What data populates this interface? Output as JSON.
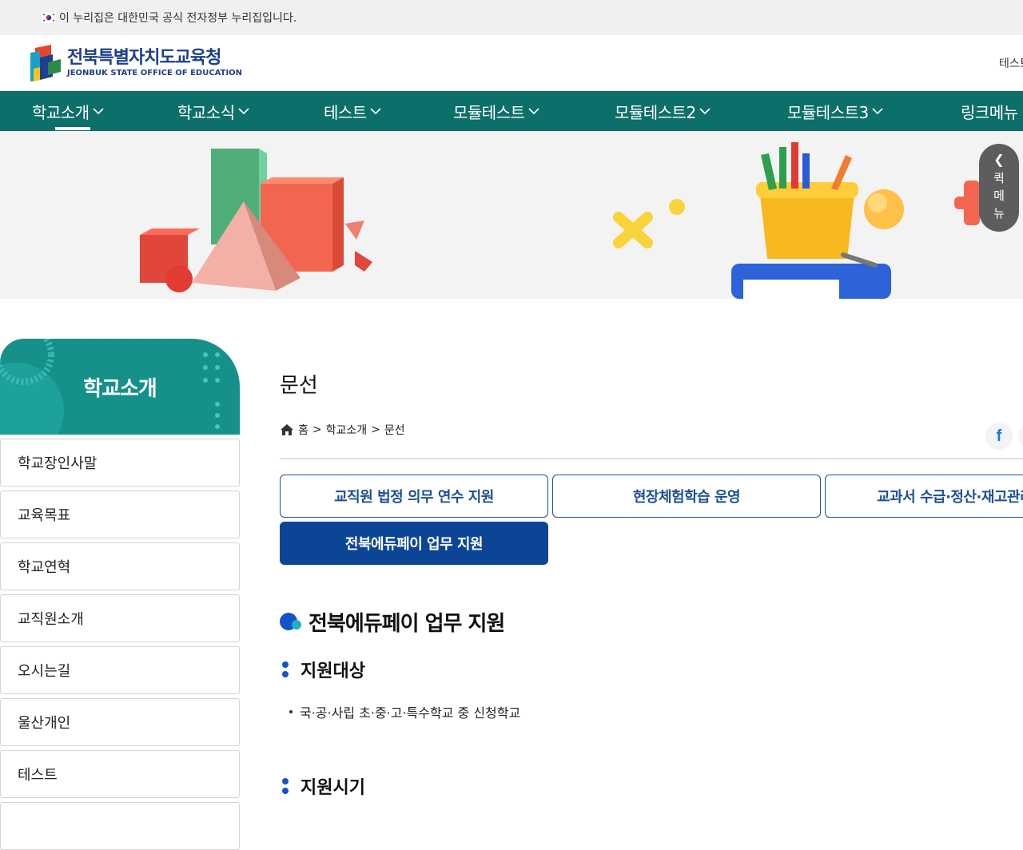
{
  "gov_banner": {
    "text": "이 누리집은 대한민국 공식 전자정부 누리집입니다."
  },
  "logo": {
    "name_ko": "전북특별자치도교육청",
    "name_en": "JEONBUK STATE OFFICE OF EDUCATION"
  },
  "header": {
    "right_text": "테스트"
  },
  "gnb": {
    "items": [
      "학교소개",
      "학교소식",
      "테스트",
      "모듈테스트",
      "모듈테스트2",
      "모듈테스트3",
      "링크메뉴"
    ],
    "active_index": 0
  },
  "quick_menu": {
    "arrow": "❮",
    "label_lines": [
      "퀵",
      "메",
      "뉴"
    ]
  },
  "lnb": {
    "title": "학교소개",
    "items": [
      "학교장인사말",
      "교육목표",
      "학교연혁",
      "교직원소개",
      "오시는길",
      "울산개인",
      "테스트",
      ""
    ]
  },
  "content": {
    "page_title": "문선",
    "breadcrumb": [
      "홈",
      "학교소개",
      "문선"
    ],
    "breadcrumb_separator": ">",
    "share_facebook": "f",
    "tabs": [
      {
        "label": "교직원 법정 의무 연수 지원",
        "active": false
      },
      {
        "label": "현장체험학습 운영",
        "active": false
      },
      {
        "label": "교과서 수급·정산·재고관리",
        "active": false
      },
      {
        "label": "전북에듀페이 업무 지원",
        "active": true
      }
    ],
    "section_title": "전북에듀페이 업무 지원",
    "subsections": [
      {
        "title": "지원대상",
        "items": [
          "국·공·사립 초·중·고·특수학교 중 신청학교"
        ]
      },
      {
        "title": "지원시기",
        "items": []
      }
    ]
  },
  "colors": {
    "gnb_bg": "#0d6f6a",
    "lnb_head_bg": "#16918a",
    "tab_active_bg": "#0d4596",
    "tab_border": "#1f4f95",
    "logo_text": "#1d3f8f"
  }
}
